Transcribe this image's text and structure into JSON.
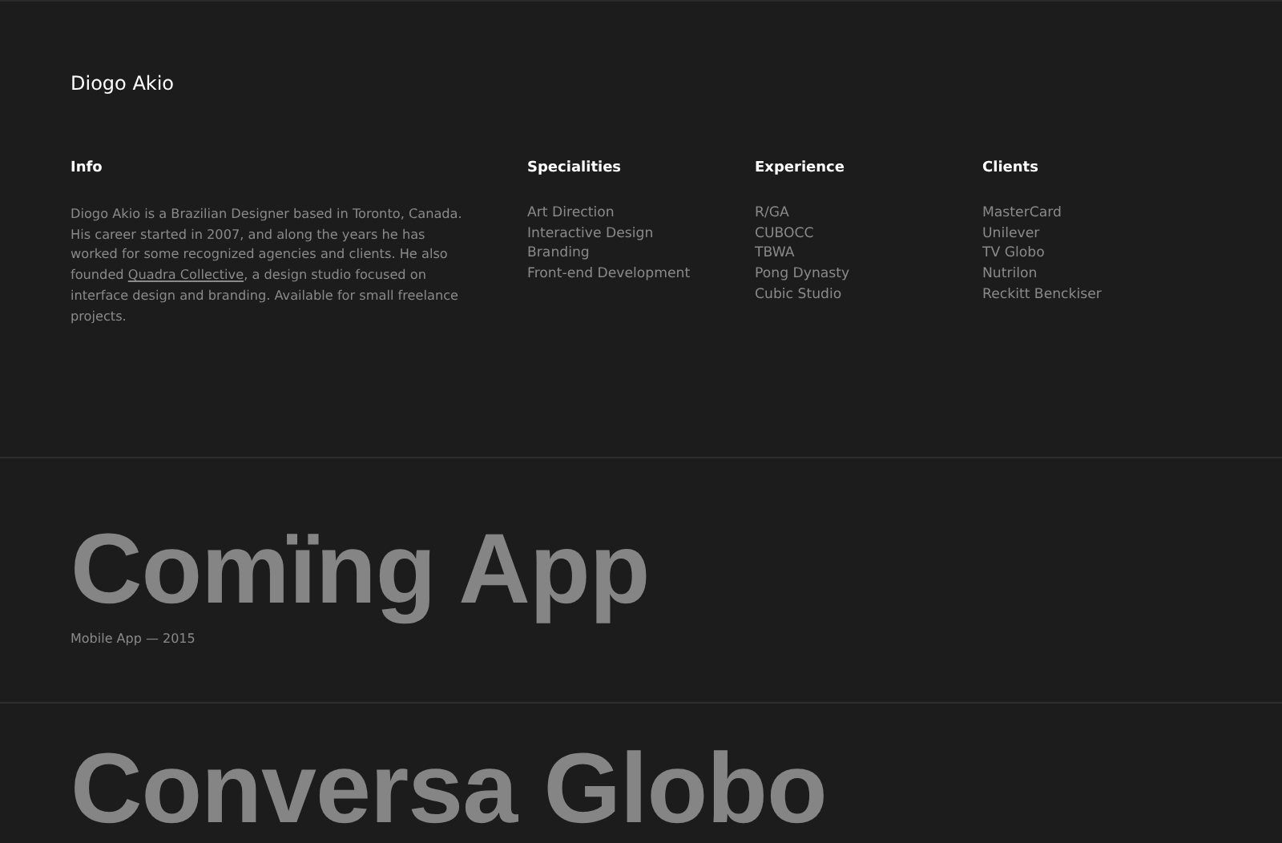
{
  "site_title": "Diogo Akio",
  "info": {
    "heading": "Info",
    "bio_before": "Diogo Akio is a Brazilian Designer based in Toronto, Canada. His career started in 2007, and along the years he has worked for some recognized agencies and clients. He also founded ",
    "bio_link": "Quadra Collective",
    "bio_after": ", a design studio focused on interface design and branding. Available for small freelance projects."
  },
  "lists": [
    {
      "heading": "Specialities",
      "items": [
        "Art Direction",
        "Interactive Design",
        "Branding",
        "Front-end Development"
      ]
    },
    {
      "heading": "Experience",
      "items": [
        "R/GA",
        "CUBOCC",
        "TBWA",
        "Pong Dynasty",
        "Cubic Studio"
      ]
    },
    {
      "heading": "Clients",
      "items": [
        "MasterCard",
        "Unilever",
        "TV Globo",
        "Nutrilon",
        "Reckitt Benckiser"
      ]
    }
  ],
  "projects": [
    {
      "title": "Comïng App",
      "subtitle": "Mobile App — 2015"
    },
    {
      "title": "Conversa Globo"
    }
  ]
}
